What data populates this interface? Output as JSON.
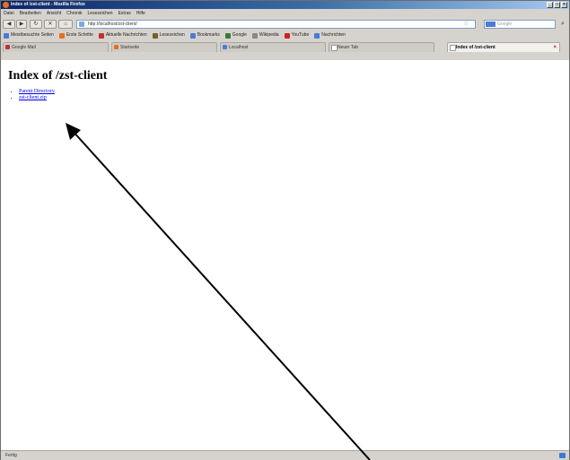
{
  "window": {
    "title": "Index of /zst-client - Mozilla Firefox"
  },
  "menu": [
    "Datei",
    "Bearbeiten",
    "Ansicht",
    "Chronik",
    "Lesezeichen",
    "Extras",
    "Hilfe"
  ],
  "address": {
    "url": "http://localhost/zst-client/"
  },
  "search": {
    "placeholder": "Google"
  },
  "bookmarks": [
    {
      "label": "Meistbesuchte Seiten",
      "color": "#4a7bd6"
    },
    {
      "label": "Erste Schritte",
      "color": "#e76f1f"
    },
    {
      "label": "Aktuelle Nachrichten",
      "color": "#c03030"
    },
    {
      "label": "Lesezeichen",
      "color": "#7a5c2e"
    },
    {
      "label": "Bookmarks",
      "color": "#4a7bd6"
    },
    {
      "label": "Google",
      "color": "#3a7a3a"
    },
    {
      "label": "Wikipedia",
      "color": "#888888"
    },
    {
      "label": "YouTube",
      "color": "#d02020"
    },
    {
      "label": "Nachrichten",
      "color": "#4a7bd6"
    }
  ],
  "tabs": [
    {
      "label": "Google Mail",
      "color": "#c03030"
    },
    {
      "label": "Startseite",
      "color": "#e76f1f"
    },
    {
      "label": "Localhost",
      "color": "#4a7bd6"
    },
    {
      "label": "Neuer Tab",
      "color": "#ffffff"
    },
    {
      "label": "Index of /zst-client",
      "color": "#ffffff"
    }
  ],
  "page": {
    "heading": "Index of /zst-client",
    "items": [
      "Parent Directory",
      "zst-client.zip"
    ]
  },
  "status": {
    "text": "Fertig"
  },
  "colors": {
    "link": "#0000ee",
    "arrow": "#000000"
  }
}
